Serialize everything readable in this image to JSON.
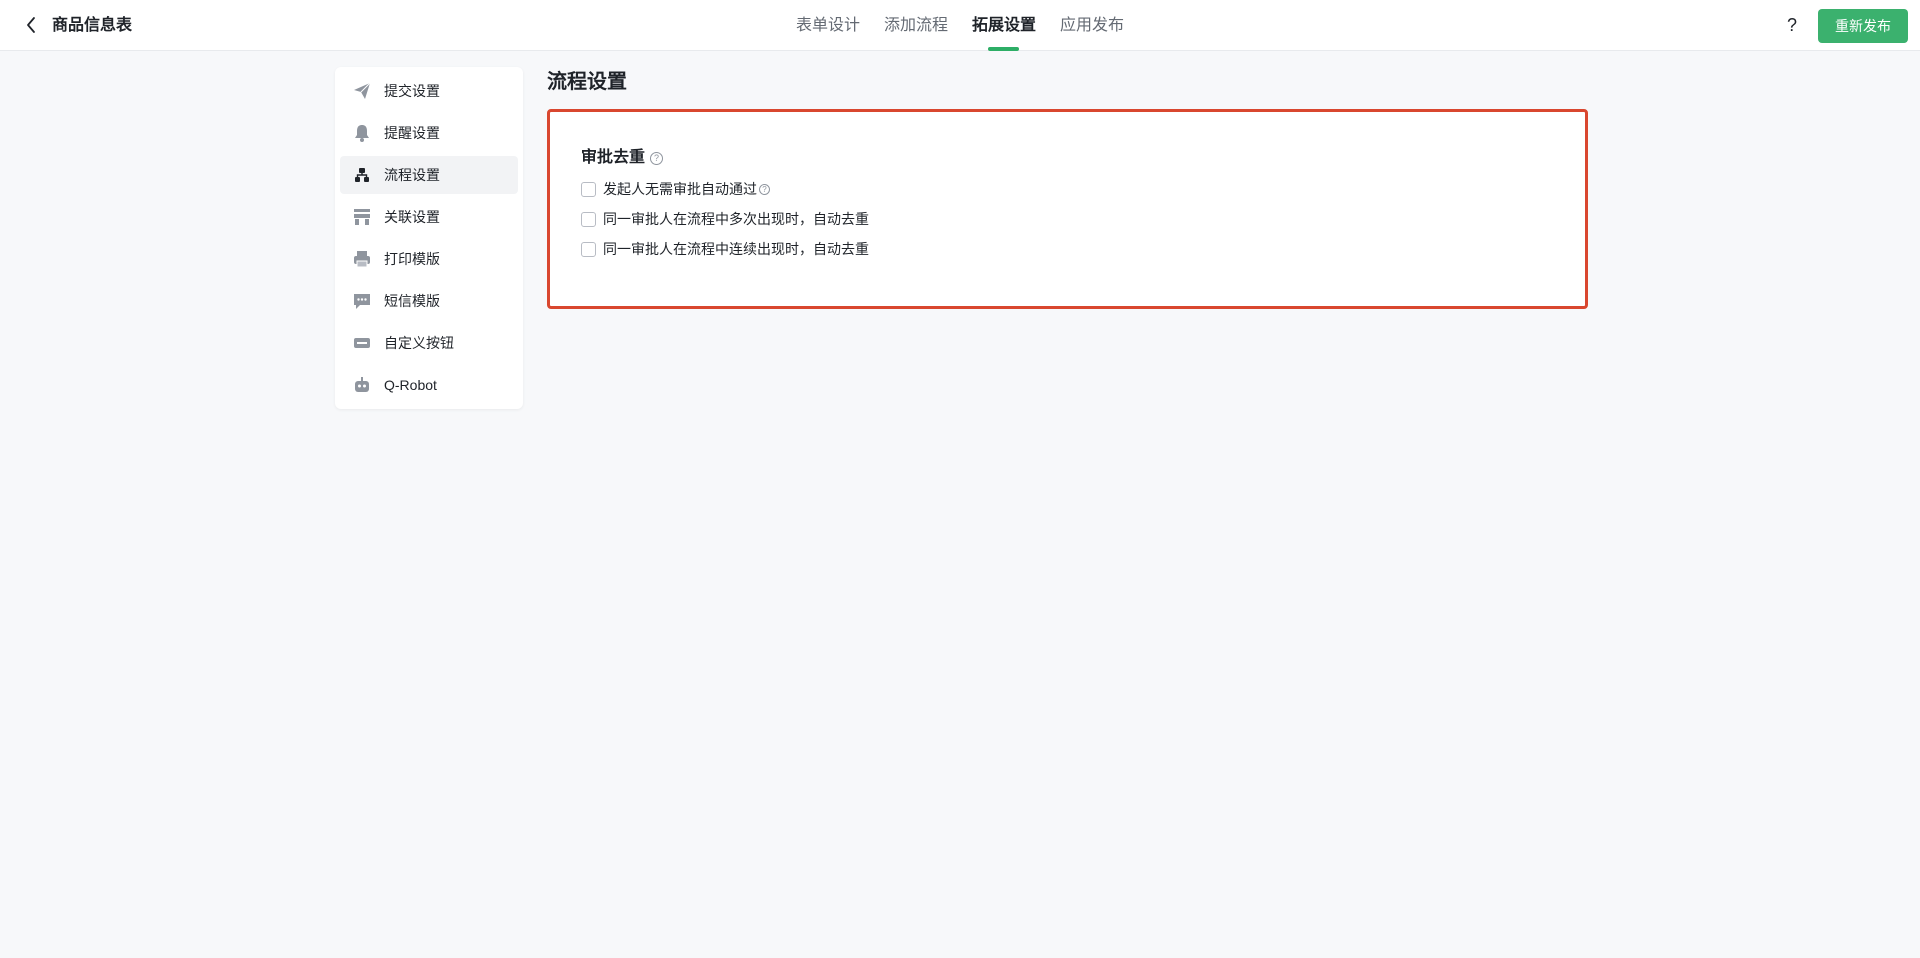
{
  "header": {
    "title": "商品信息表",
    "tabs": [
      {
        "label": "表单设计"
      },
      {
        "label": "添加流程"
      },
      {
        "label": "拓展设置"
      },
      {
        "label": "应用发布"
      }
    ],
    "active_tab": "拓展设置",
    "help_label": "?",
    "publish_label": "重新发布",
    "accent_color": "#3bb16e"
  },
  "sidebar": {
    "items": [
      {
        "label": "提交设置",
        "icon": "paper-plane-icon"
      },
      {
        "label": "提醒设置",
        "icon": "bell-icon"
      },
      {
        "label": "流程设置",
        "icon": "flow-icon"
      },
      {
        "label": "关联设置",
        "icon": "link-settings-icon"
      },
      {
        "label": "打印模版",
        "icon": "printer-icon"
      },
      {
        "label": "短信模版",
        "icon": "message-icon"
      },
      {
        "label": "自定义按钮",
        "icon": "custom-button-icon"
      },
      {
        "label": "Q-Robot",
        "icon": "robot-icon"
      }
    ],
    "active_item": "流程设置"
  },
  "main": {
    "section_title": "流程设置",
    "group": {
      "title": "审批去重",
      "help_glyph": "?",
      "options": [
        {
          "label": "发起人无需审批自动通过",
          "checked": false,
          "has_help": true
        },
        {
          "label": "同一审批人在流程中多次出现时，自动去重",
          "checked": false,
          "has_help": false
        },
        {
          "label": "同一审批人在流程中连续出现时，自动去重",
          "checked": false,
          "has_help": false
        }
      ]
    },
    "highlight_color": "#d9472f"
  }
}
